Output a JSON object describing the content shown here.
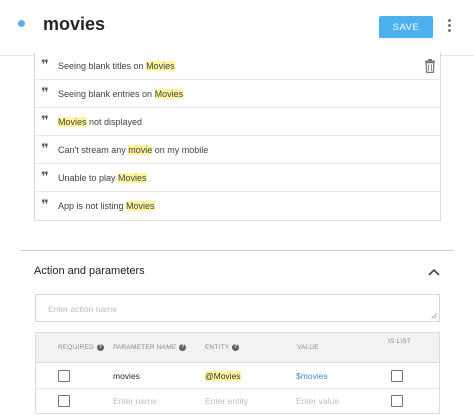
{
  "header": {
    "title": "movies",
    "save_label": "SAVE",
    "colors": {
      "accent": "#4ab0ee",
      "status_dot": "#5bb0e8",
      "highlight": "#fff59d"
    }
  },
  "phrases": [
    {
      "before": "Seeing blank titles on ",
      "highlight": "Movies",
      "after": ""
    },
    {
      "before": "Seeing blank entries on ",
      "highlight": "Movies",
      "after": ""
    },
    {
      "before": "",
      "highlight": "Movies",
      "after": " not displayed"
    },
    {
      "before": "Can't stream any ",
      "highlight": "movie",
      "after": " on my mobile"
    },
    {
      "before": "Unable to play ",
      "highlight": "Movies",
      "after": ""
    },
    {
      "before": "App is not listing ",
      "highlight": "Movies",
      "after": ""
    }
  ],
  "action_section": {
    "title": "Action and parameters",
    "action_placeholder": "Enter action name"
  },
  "params_table": {
    "headers": {
      "required": "REQUIRED",
      "parameter_name": "PARAMETER NAME",
      "entity": "ENTITY",
      "value": "VALUE",
      "is_list": "IS LIST"
    },
    "help_glyph": "?",
    "rows": [
      {
        "required": false,
        "name": "movies",
        "entity": "@Movies",
        "value": "$movies",
        "is_list": false
      }
    ],
    "new_row": {
      "name_placeholder": "Enter name",
      "entity_placeholder": "Enter entity",
      "value_placeholder": "Enter value"
    }
  },
  "icons": [
    "more-vert-icon",
    "quote-icon",
    "trash-icon",
    "chevron-up-icon",
    "help-icon",
    "resize-handle-icon"
  ]
}
